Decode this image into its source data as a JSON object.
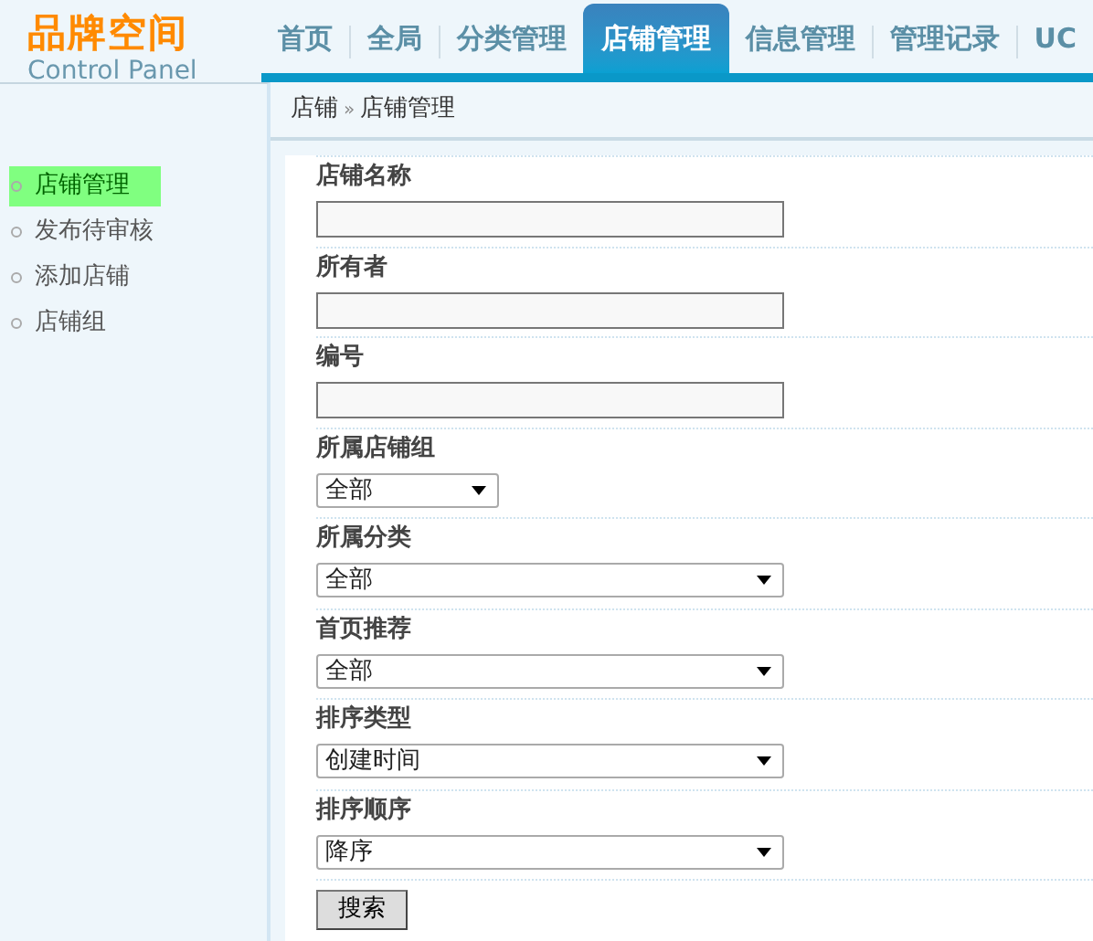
{
  "logo": {
    "title": "品牌空间",
    "subtitle": "Control Panel"
  },
  "tabs": [
    {
      "label": "首页",
      "selected": false
    },
    {
      "label": "全局",
      "selected": false
    },
    {
      "label": "分类管理",
      "selected": false
    },
    {
      "label": "店铺管理",
      "selected": true
    },
    {
      "label": "信息管理",
      "selected": false
    },
    {
      "label": "管理记录",
      "selected": false
    },
    {
      "label": "UC",
      "selected": false
    }
  ],
  "breadcrumb": {
    "parent": "店铺",
    "separator": "»",
    "current": "店铺管理"
  },
  "sidebar": {
    "items": [
      {
        "label": "店铺管理",
        "selected": true
      },
      {
        "label": "发布待审核",
        "selected": false
      },
      {
        "label": "添加店铺",
        "selected": false
      },
      {
        "label": "店铺组",
        "selected": false
      }
    ]
  },
  "form": {
    "fields": [
      {
        "label": "店铺名称",
        "kind": "text"
      },
      {
        "label": "所有者",
        "kind": "text"
      },
      {
        "label": "编号",
        "kind": "text"
      },
      {
        "label": "所属店铺组",
        "kind": "select",
        "wide": false,
        "value": "全部"
      },
      {
        "label": "所属分类",
        "kind": "select",
        "wide": true,
        "value": "全部"
      },
      {
        "label": "首页推荐",
        "kind": "select",
        "wide": true,
        "value": "全部"
      },
      {
        "label": "排序类型",
        "kind": "select",
        "wide": true,
        "value": "创建时间"
      },
      {
        "label": "排序顺序",
        "kind": "select",
        "wide": true,
        "value": "降序"
      }
    ],
    "submit": "搜索"
  }
}
